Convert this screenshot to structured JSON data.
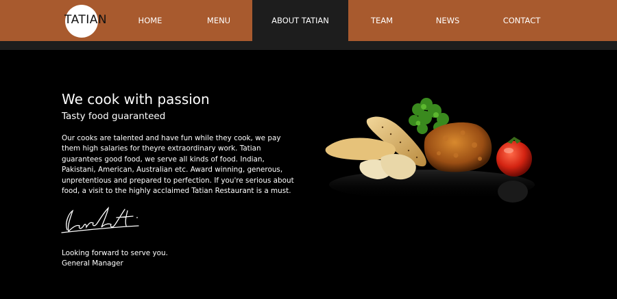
{
  "logo": {
    "text": "TATIAN"
  },
  "nav": {
    "items": [
      {
        "label": "HOME"
      },
      {
        "label": "MENU"
      },
      {
        "label": "ABOUT TATIAN"
      },
      {
        "label": "TEAM"
      },
      {
        "label": "NEWS"
      },
      {
        "label": "CONTACT"
      }
    ],
    "active": "ABOUT TATIAN"
  },
  "content": {
    "headline": "We cook with passion",
    "subheadline": "Tasty food guaranteed",
    "paragraph": "Our cooks are talented and have fun while they cook, we pay them high salaries for theyre extraordinary work. Tatian guarantees good food, we serve all kinds of food. Indian, Pakistani, American, Australian etc. Award winning, generous, unpretentious and prepared to perfection. If you're serious about food, a visit to the highly acclaimed Tatian Restaurant is a must.",
    "closing_line1": "Looking forward to serve you.",
    "closing_line2": "General Manager"
  },
  "colors": {
    "nav_bar": "#a85a2e",
    "nav_active": "#1d1d1d",
    "page_background": "#000000",
    "text": "#ffffff"
  }
}
